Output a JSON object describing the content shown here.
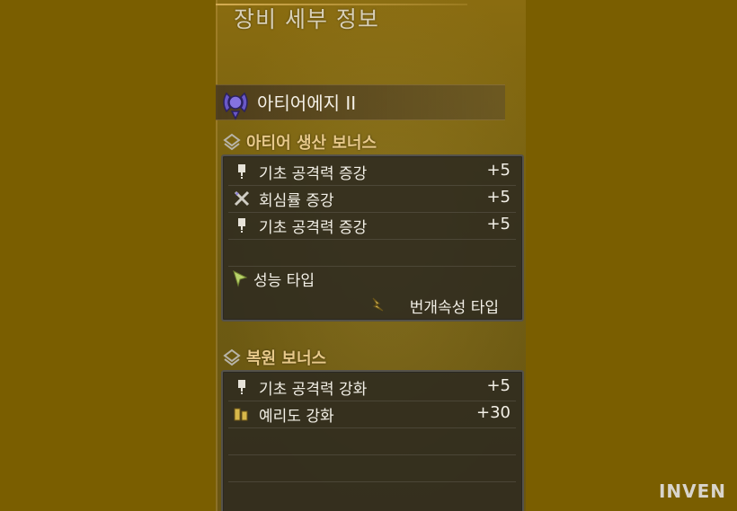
{
  "title": "장비 세부 정보",
  "equipment": {
    "name": "아티어에지 II",
    "icon": "weapon-emblem-icon"
  },
  "production_bonus": {
    "title": "아티어 생산 보너스",
    "rows": [
      {
        "icon": "attack-icon",
        "label": "기초 공격력 증강",
        "value": "+5"
      },
      {
        "icon": "crossed-swords-icon",
        "label": "회심률 증강",
        "value": "+5"
      },
      {
        "icon": "attack-icon",
        "label": "기초 공격력 증강",
        "value": "+5"
      }
    ],
    "performance_label": "성능 타입",
    "element_label": "번개속성 타입"
  },
  "restore_bonus": {
    "title": "복원 보너스",
    "rows": [
      {
        "icon": "attack-icon",
        "label": "기초 공격력 강화",
        "value": "+5"
      },
      {
        "icon": "sharpness-icon",
        "label": "예리도 강화",
        "value": "+30"
      }
    ]
  },
  "watermark": "INVEN",
  "colors": {
    "background": "#7a5e00",
    "section_title": "#e8c98a",
    "box": "#2d2a20"
  }
}
